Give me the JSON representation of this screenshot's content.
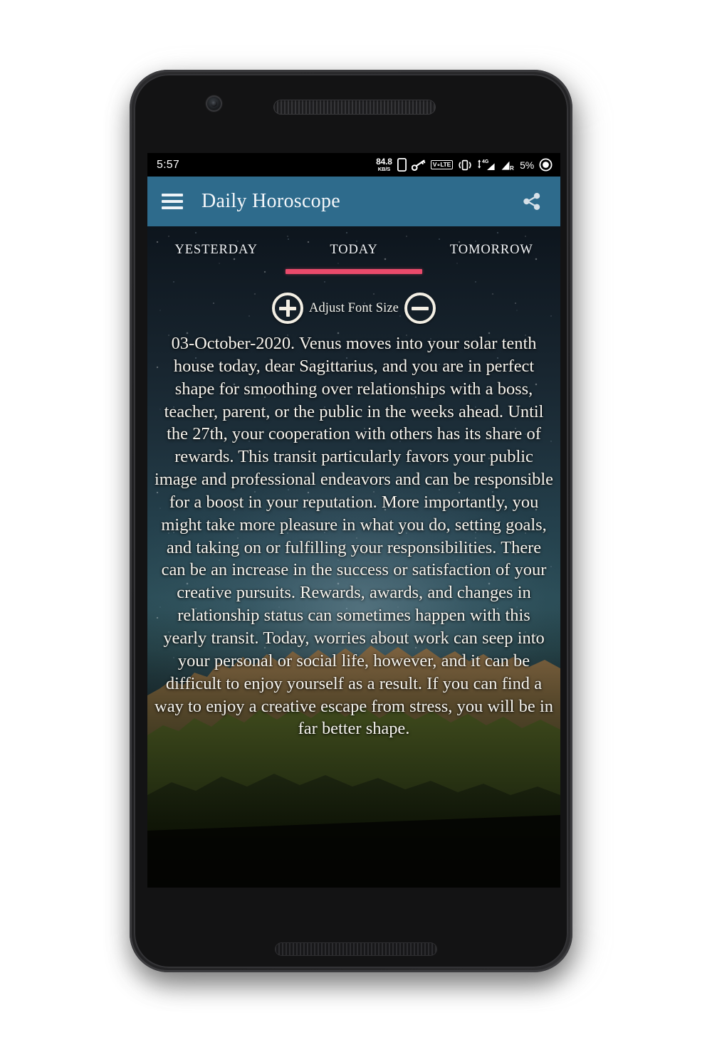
{
  "status_bar": {
    "time": "5:57",
    "net_speed_value": "84.8",
    "net_speed_unit": "KB/S",
    "volte_label": "V∘LTE",
    "network_type": "4G",
    "roaming_label": "R",
    "battery_percent": "5%",
    "icons": [
      "sim-card-icon",
      "key-icon",
      "volte-icon",
      "vibrate-icon",
      "signal-4g-icon",
      "signal-roaming-icon",
      "battery-icon"
    ]
  },
  "app_bar": {
    "title": "Daily Horoscope",
    "menu_icon": "hamburger-menu-icon",
    "share_icon": "share-icon",
    "background_color": "#2e6b8c"
  },
  "tabs": {
    "items": [
      {
        "label": "YESTERDAY",
        "selected": false
      },
      {
        "label": "TODAY",
        "selected": true
      },
      {
        "label": "TOMORROW",
        "selected": false
      }
    ],
    "indicator_color": "#ea4a6b"
  },
  "font_controls": {
    "increase_label": "+",
    "decrease_label": "−",
    "label": "Adjust Font Size",
    "increase_icon": "plus-circle-icon",
    "decrease_icon": "minus-circle-icon"
  },
  "horoscope": {
    "date": "03-October-2020.",
    "sign": "Sagittarius",
    "text": "03-October-2020. Venus moves into your solar tenth house today, dear Sagittarius, and you are in perfect shape for smoothing over relationships with a boss, teacher, parent, or the public in the weeks ahead. Until the 27th, your cooperation with others has its share of rewards. This transit particularly favors your public image and professional endeavors and can be responsible for a boost in your reputation. More importantly, you might take more pleasure in what you do, setting goals, and taking on or fulfilling your responsibilities. There can be an increase in the success or satisfaction of your creative pursuits. Rewards, awards, and changes in relationship status can sometimes happen with this yearly transit. Today, worries about work can seep into your personal or social life, however, and it can be difficult to enjoy yourself as a result. If you can find a way to enjoy a creative escape from stress, you will be in far better shape."
  }
}
